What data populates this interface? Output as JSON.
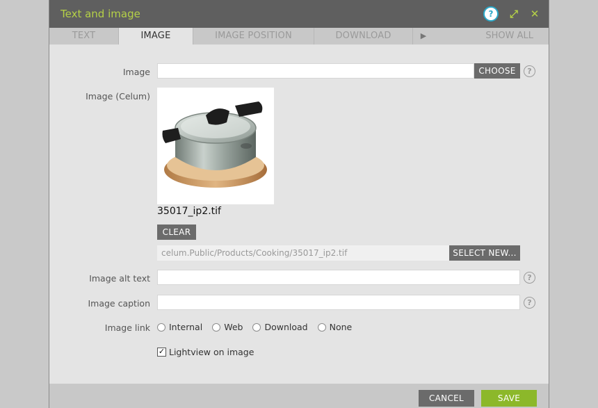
{
  "window": {
    "title": "Text and image"
  },
  "titlebar_icons": {
    "help": "?",
    "expand": "⤢",
    "close": "✕"
  },
  "tabs": [
    {
      "label": "TEXT"
    },
    {
      "label": "IMAGE"
    },
    {
      "label": "IMAGE POSITION"
    },
    {
      "label": "DOWNLOAD"
    }
  ],
  "tab_more": "▶",
  "show_all": "SHOW ALL",
  "form": {
    "image_label": "Image",
    "choose_button": "CHOOSE",
    "image_celum_label": "Image (Celum)",
    "filename": "35017_ip2.tif",
    "clear_button": "CLEAR",
    "celum_path": "celum.Public/Products/Cooking/35017_ip2.tif",
    "select_new_button": "SELECT NEW...",
    "alt_text_label": "Image alt text",
    "caption_label": "Image caption",
    "image_link_label": "Image link",
    "link_options": [
      "Internal",
      "Web",
      "Download",
      "None"
    ],
    "lightview_label": "Lightview on image",
    "help": "?"
  },
  "footer": {
    "cancel": "CANCEL",
    "save": "SAVE"
  },
  "colors": {
    "accent": "#b5d147",
    "save": "#8cb82a",
    "titlebar": "#5f5f5f"
  }
}
